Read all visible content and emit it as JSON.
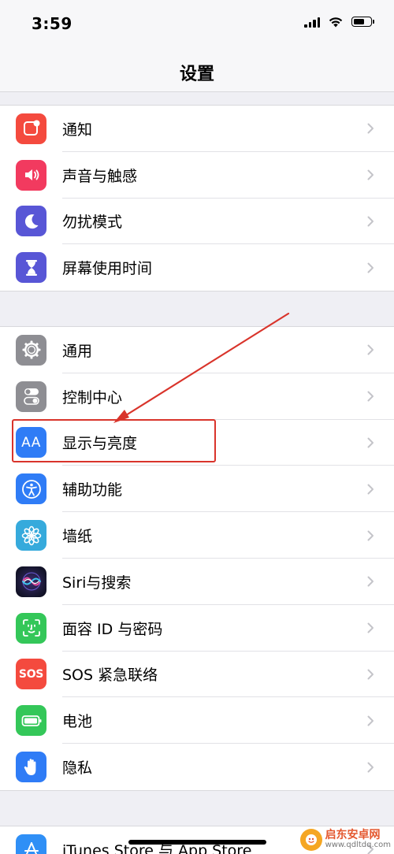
{
  "status_bar": {
    "time": "3:59"
  },
  "nav": {
    "title": "设置"
  },
  "groups": [
    {
      "items": [
        {
          "label": "通知",
          "icon": "notifications-icon",
          "color": "#f44a3e"
        },
        {
          "label": "声音与触感",
          "icon": "sounds-icon",
          "color": "#f23a5f"
        },
        {
          "label": "勿扰模式",
          "icon": "moon-icon",
          "color": "#5856d6"
        },
        {
          "label": "屏幕使用时间",
          "icon": "hourglass-icon",
          "color": "#5856d6"
        }
      ]
    },
    {
      "items": [
        {
          "label": "通用",
          "icon": "gear-icon",
          "color": "#8e8e93"
        },
        {
          "label": "控制中心",
          "icon": "toggles-icon",
          "color": "#8e8e93"
        },
        {
          "label": "显示与亮度",
          "icon": "text-size-icon",
          "color": "#2f7cf6"
        },
        {
          "label": "辅助功能",
          "icon": "accessibility-icon",
          "color": "#2f7cf6"
        },
        {
          "label": "墙纸",
          "icon": "flower-icon",
          "color": "#36aadc"
        },
        {
          "label": "Siri与搜索",
          "icon": "siri-icon",
          "color": "#1c1c3a"
        },
        {
          "label": "面容 ID 与密码",
          "icon": "face-id-icon",
          "color": "#34c759"
        },
        {
          "label": "SOS 紧急联络",
          "icon": "sos-icon",
          "color": "#f44a3e"
        },
        {
          "label": "电池",
          "icon": "battery-icon",
          "color": "#34c759"
        },
        {
          "label": "隐私",
          "icon": "hand-icon",
          "color": "#2f7cf6"
        }
      ]
    },
    {
      "items": [
        {
          "label": "iTunes Store 与 App Store",
          "icon": "app-store-icon",
          "color": "#2f8ff6"
        }
      ]
    }
  ],
  "icon_text": {
    "text_size": "AA",
    "sos": "SOS"
  },
  "annotation": {
    "color": "#d9342b",
    "highlighted_item": "显示与亮度"
  },
  "watermark": {
    "name": "启东安卓网",
    "url": "www.qdltdq.com"
  }
}
